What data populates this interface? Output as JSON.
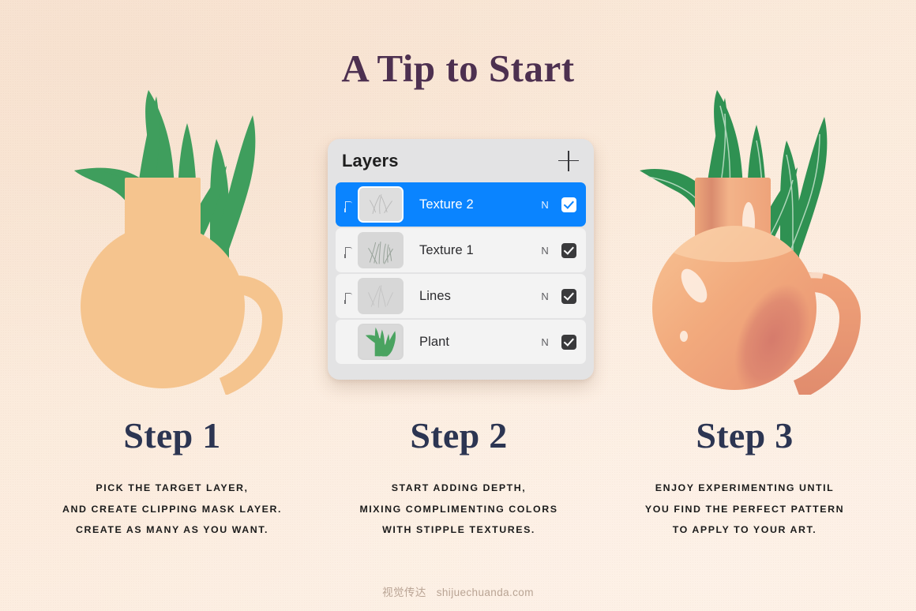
{
  "page": {
    "title": "A Tip to Start",
    "background_color": "#fbebdc",
    "accent_color": "#0a84ff",
    "title_color": "#4d3050",
    "step_heading_color": "#2c3552"
  },
  "layers_panel": {
    "title": "Layers",
    "add_button_label": "+",
    "rows": [
      {
        "name": "Texture 2",
        "blend_mode": "N",
        "visible": true,
        "selected": true,
        "clipped": true,
        "thumb": "texture-2"
      },
      {
        "name": "Texture 1",
        "blend_mode": "N",
        "visible": true,
        "selected": false,
        "clipped": true,
        "thumb": "texture-1"
      },
      {
        "name": "Lines",
        "blend_mode": "N",
        "visible": true,
        "selected": false,
        "clipped": true,
        "thumb": "lines"
      },
      {
        "name": "Plant",
        "blend_mode": "N",
        "visible": true,
        "selected": false,
        "clipped": false,
        "thumb": "plant"
      }
    ]
  },
  "steps": [
    {
      "heading": "Step 1",
      "lines": [
        "Pick the target layer,",
        "and create clipping mask layer.",
        "Create as many as you want."
      ]
    },
    {
      "heading": "Step 2",
      "lines": [
        "Start adding depth,",
        "mixing complimenting colors",
        "with stipple textures."
      ]
    },
    {
      "heading": "Step 3",
      "lines": [
        "Enjoy experimenting until",
        "you find the perfect pattern",
        "to apply to your art."
      ]
    }
  ],
  "illustrations": {
    "left": {
      "name": "flat-vase-with-plant",
      "vase_color": "#f5c48e",
      "leaf_color": "#3f9e5d"
    },
    "right": {
      "name": "shaded-vase-with-plant",
      "vase_color": "#f0a778",
      "leaf_color": "#2f9152",
      "shadow_color": "#d4796b",
      "highlight_color": "#fce8d8"
    }
  },
  "watermark": {
    "cn": "视觉传达",
    "site": "shijuechuanda.com"
  }
}
